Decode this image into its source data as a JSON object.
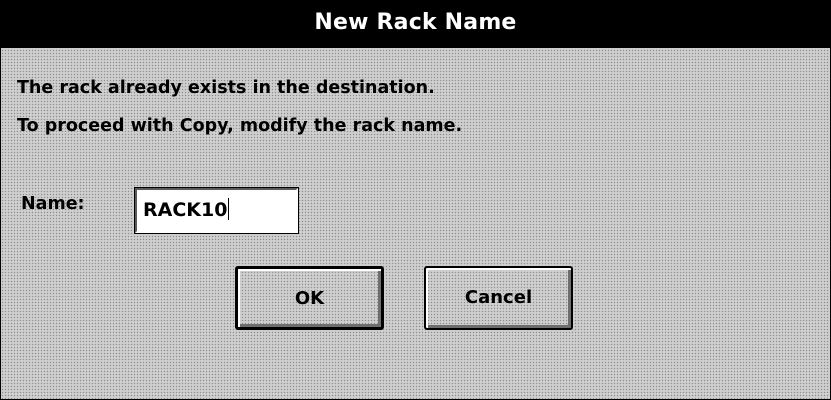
{
  "dialog": {
    "title": "New Rack Name",
    "message_line1": "The rack already exists in the destination.",
    "message_line2": "To proceed with Copy, modify the rack name.",
    "name_label": "Name:",
    "name_value": "RACK10",
    "ok_label": "OK",
    "cancel_label": "Cancel"
  }
}
